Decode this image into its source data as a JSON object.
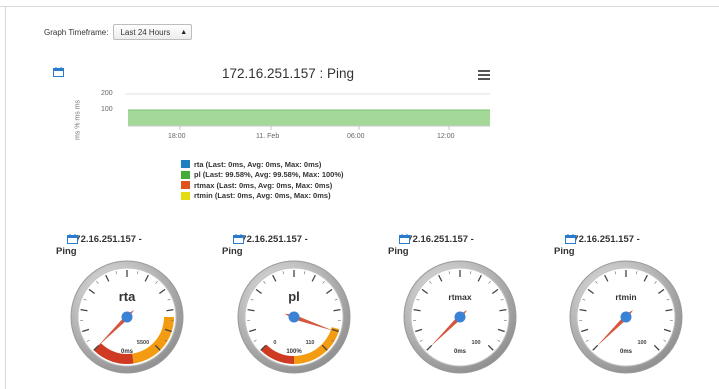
{
  "timeframe": {
    "label": "Graph Timeframe:",
    "selected": "Last 24 Hours"
  },
  "chart": {
    "title": "172.16.251.157 : Ping"
  },
  "chart_data": {
    "type": "area",
    "title": "172.16.251.157 : Ping",
    "ylabel": "ms % ms ms",
    "yticks": [
      "100",
      "200"
    ],
    "xticks": [
      "18:00",
      "11. Feb",
      "06:00",
      "12:00"
    ],
    "series": [
      {
        "name": "rta (Last: 0ms, Avg: 0ms, Max: 0ms)",
        "color": "#1f7ec0",
        "value": 0
      },
      {
        "name": "pl (Last: 99.58%, Avg: 99.58%, Max: 100%)",
        "color": "#44ad37",
        "value": 99.58
      },
      {
        "name": "rtmax (Last: 0ms, Avg: 0ms, Max: 0ms)",
        "color": "#e0531f",
        "value": 0
      },
      {
        "name": "rtmin (Last: 0ms, Avg: 0ms, Max: 0ms)",
        "color": "#e3dd10",
        "value": 0
      }
    ],
    "area_color": "#a3d898"
  },
  "gauges": [
    {
      "title_line1": "172.16.251.157 -",
      "title_line2": "Ping",
      "name": "rta",
      "max_label": "5500",
      "min_label": "0ms",
      "needle_fraction": 0.0,
      "band": "wide"
    },
    {
      "title_line1": "172.16.251.157 -",
      "title_line2": "Ping",
      "name": "pl",
      "zero_label": "0",
      "max_label": "110",
      "min_label": "100%",
      "needle_fraction": 0.905,
      "band": "narrow"
    },
    {
      "title_line1": "172.16.251.157 -",
      "title_line2": "Ping",
      "name": "rtmax",
      "max_label": "100",
      "min_label": "0ms",
      "needle_fraction": 0.0,
      "band": "none"
    },
    {
      "title_line1": "172.16.251.157 -",
      "title_line2": "Ping",
      "name": "rtmin",
      "max_label": "100",
      "min_label": "0ms",
      "needle_fraction": 0.0,
      "band": "none"
    }
  ],
  "icons": {
    "calendar": "calendar-icon",
    "menu": "hamburger-menu-icon"
  }
}
